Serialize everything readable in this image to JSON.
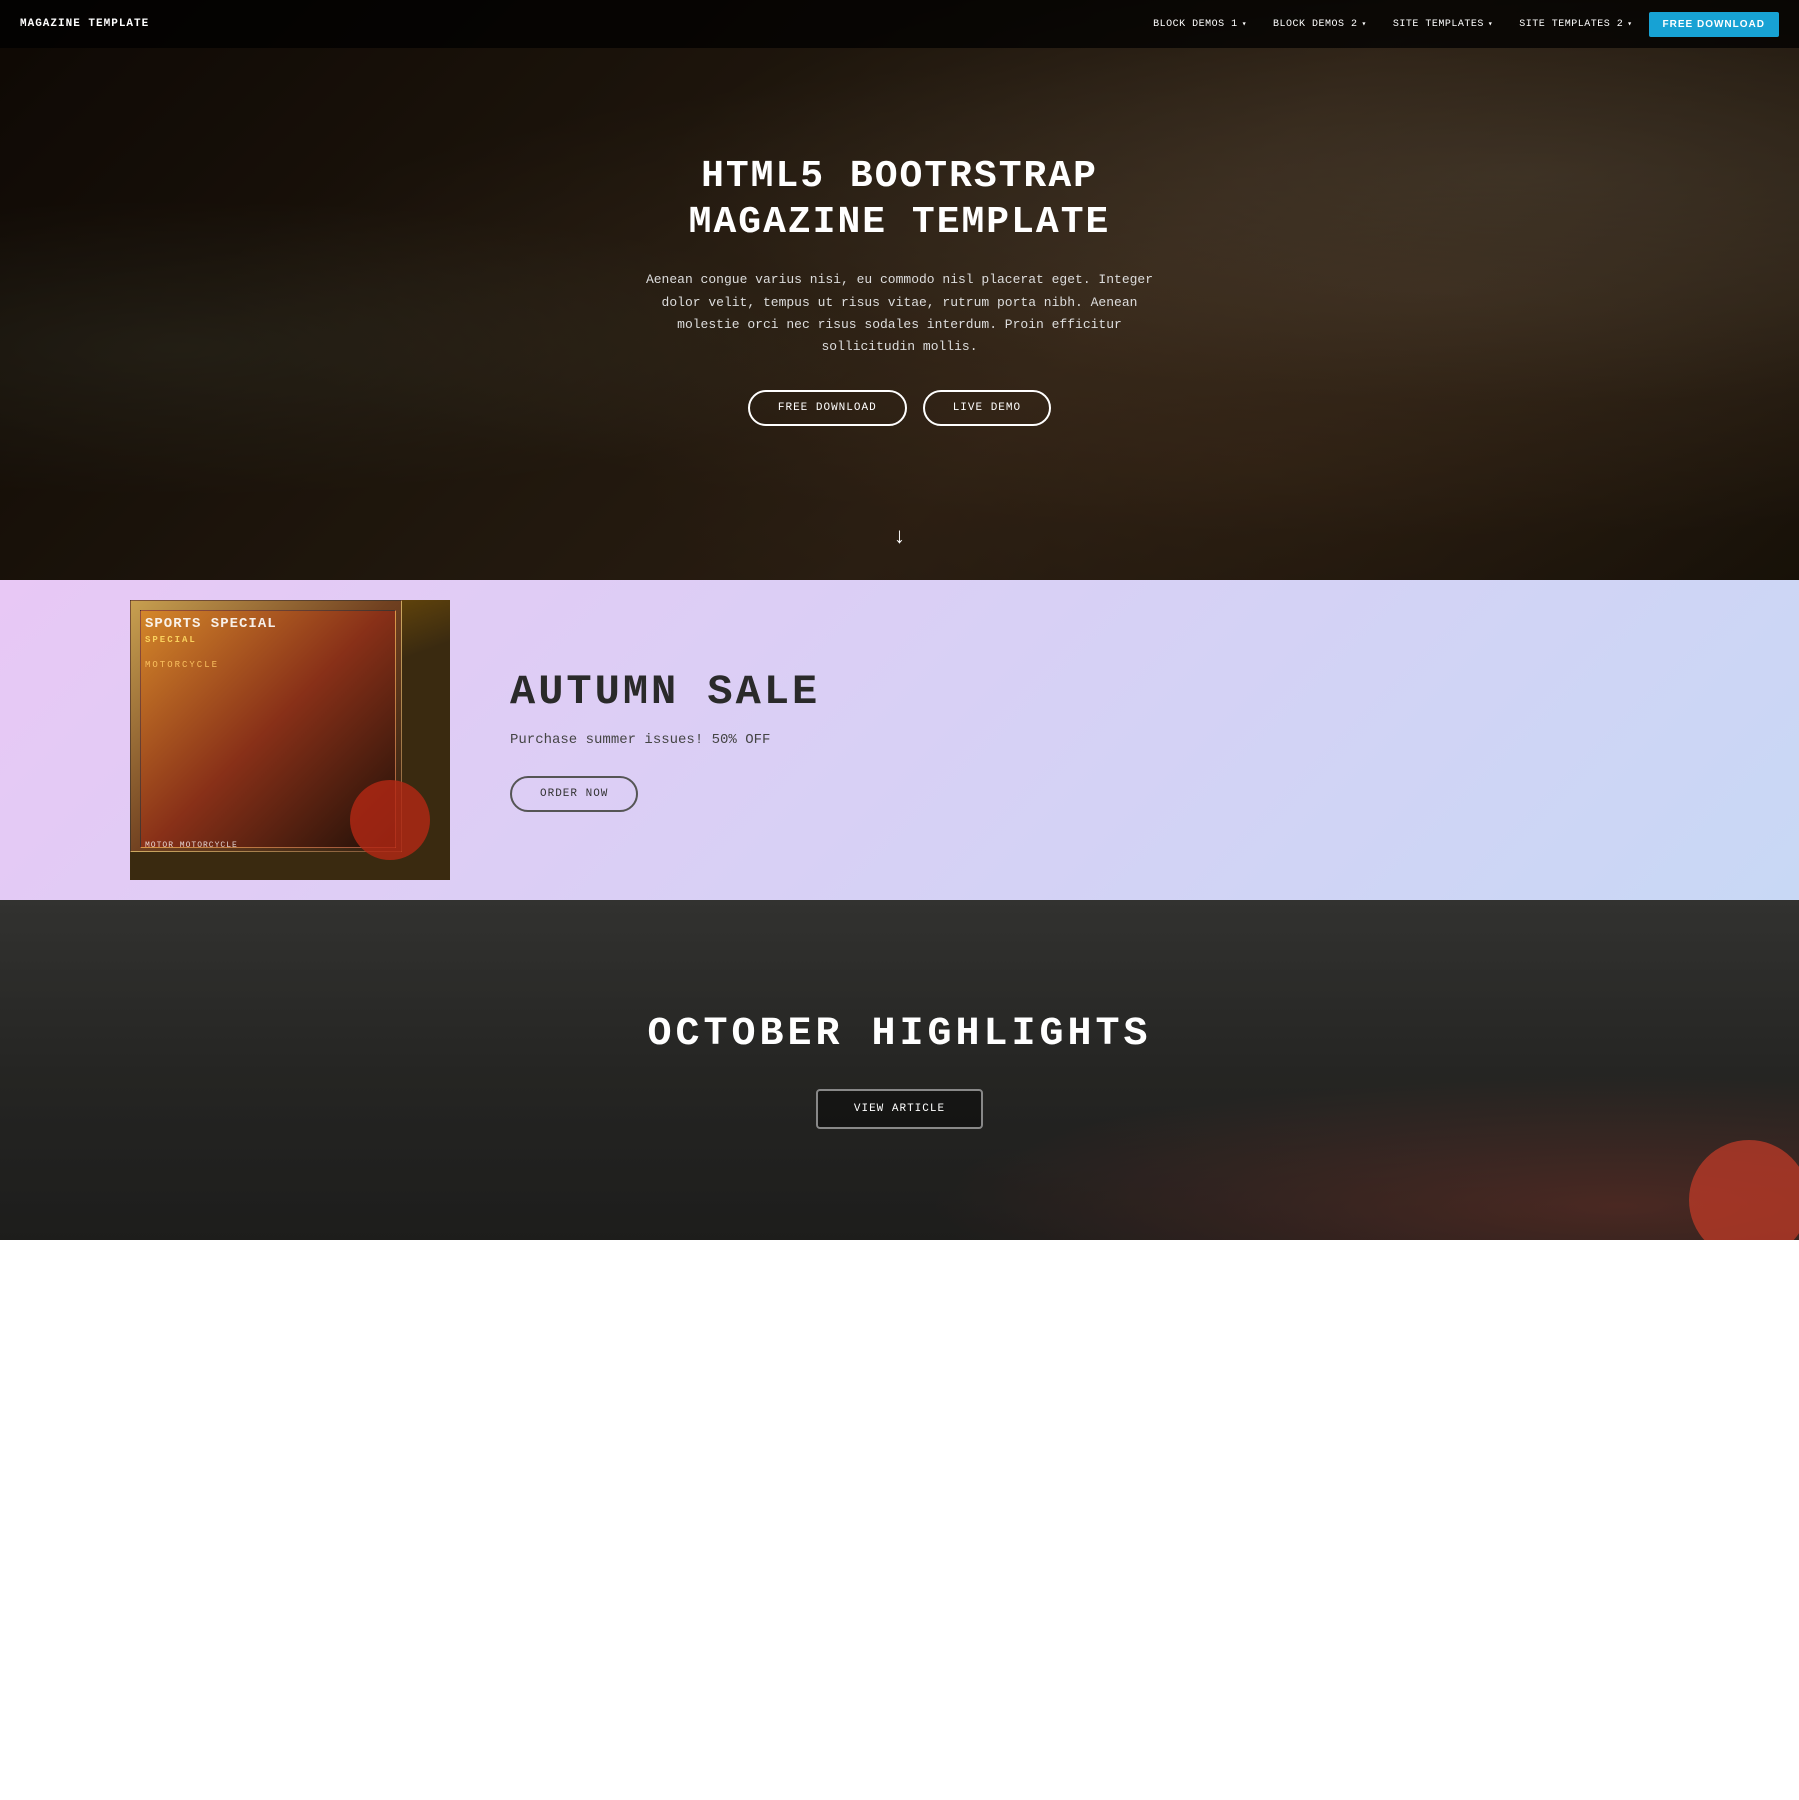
{
  "navbar": {
    "brand": "MAGAZINE TEMPLATE",
    "links": [
      {
        "id": "block-demos-1",
        "label": "BLOCK DEMOS 1",
        "hasDropdown": true
      },
      {
        "id": "block-demos-2",
        "label": "BLOCK DEMOS 2",
        "hasDropdown": true
      },
      {
        "id": "site-templates-1",
        "label": "SITE TEMPLATES",
        "hasDropdown": true
      },
      {
        "id": "site-templates-2",
        "label": "SITE TEMPLATES 2",
        "hasDropdown": true
      }
    ],
    "cta": "FREE DOWNLOAD"
  },
  "hero": {
    "title": "HTML5 BOOTRSTRAP MAGAZINE TEMPLATE",
    "description": "Aenean congue varius nisi, eu commodo nisl placerat eget. Integer dolor velit, tempus ut risus vitae, rutrum porta nibh. Aenean molestie orci nec risus sodales interdum. Proin efficitur sollicitudin mollis.",
    "btn_download": "FREE DOWNLOAD",
    "btn_demo": "LIVE DEMO",
    "scroll_icon": "↓"
  },
  "autumn_sale": {
    "title": "AUTUMN SALE",
    "subtitle": "Purchase summer issues! 50% OFF",
    "btn_order": "ORDER NOW",
    "image_alt": "Magazine stack",
    "magazine_title": "SPORTS SPECIAL",
    "magazine_sub": "MOTORCYCLE",
    "magazine_bottom": "MOTOR MOTORCYCLE"
  },
  "october": {
    "title": "OCTOBER HIGHLIGHTS",
    "btn_view": "VIEW ARTICLE"
  }
}
